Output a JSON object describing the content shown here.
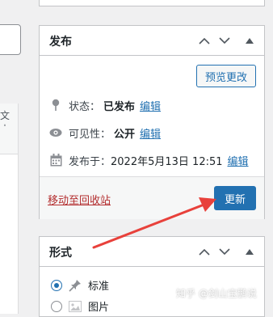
{
  "left_column": {
    "header_text": "文本"
  },
  "publish_box": {
    "title": "发布",
    "preview_button": "预览更改",
    "status": {
      "label": "状态：",
      "value": "已发布",
      "edit": "编辑"
    },
    "visibility": {
      "label": "可见性：",
      "value": "公开",
      "edit": "编辑"
    },
    "published": {
      "label": "发布于：",
      "value": "2022年5月13日 12:51",
      "edit": "编辑"
    },
    "trash_link": "移动至回收站",
    "update_button": "更新"
  },
  "format_box": {
    "title": "形式",
    "options": [
      {
        "label": "标准",
        "selected": true
      },
      {
        "label": "图片",
        "selected": false
      }
    ]
  },
  "watermark": {
    "text": "知乎 @剑山宝鹏说"
  },
  "colors": {
    "accent": "#2271b1",
    "danger": "#b32d2e",
    "arrow": "#e8413b"
  }
}
